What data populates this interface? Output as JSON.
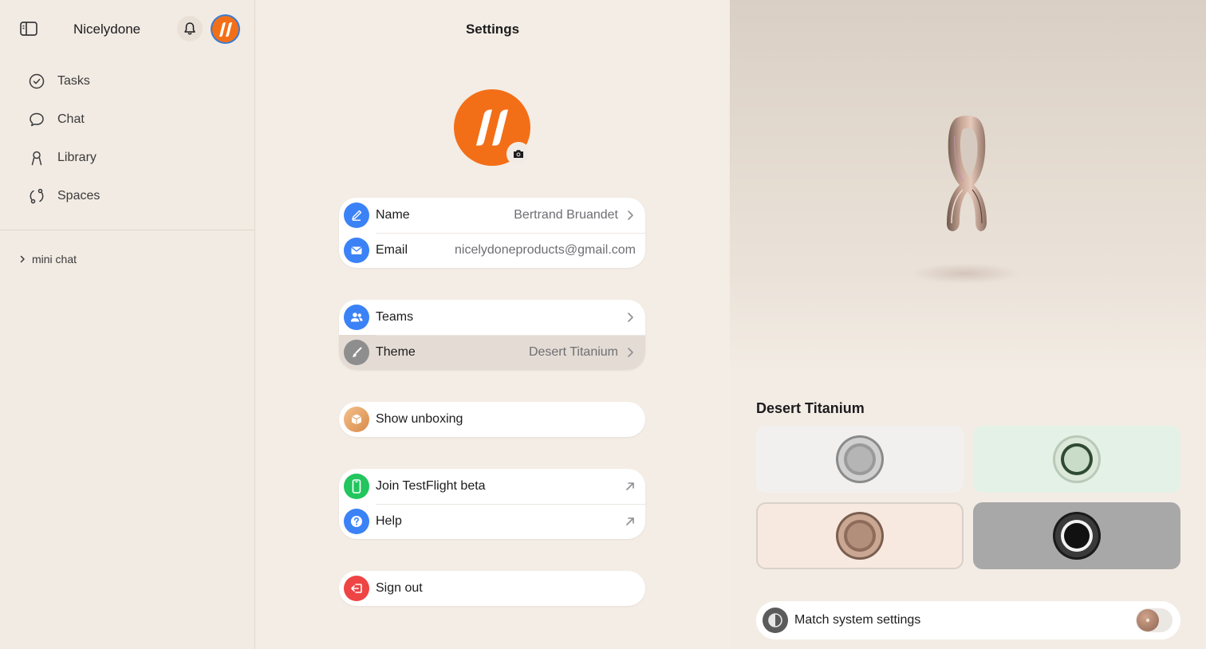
{
  "sidebar": {
    "title": "Nicelydone",
    "nav": [
      {
        "label": "Tasks"
      },
      {
        "label": "Chat"
      },
      {
        "label": "Library"
      },
      {
        "label": "Spaces"
      }
    ],
    "mini_chat_label": "mini chat"
  },
  "settings": {
    "title": "Settings",
    "name_label": "Name",
    "name_value": "Bertrand Bruandet",
    "email_label": "Email",
    "email_value": "nicelydoneproducts@gmail.com",
    "teams_label": "Teams",
    "theme_label": "Theme",
    "theme_value": "Desert Titanium",
    "unboxing_label": "Show unboxing",
    "testflight_label": "Join TestFlight beta",
    "help_label": "Help",
    "signout_label": "Sign out"
  },
  "preview": {
    "theme_name": "Desert Titanium",
    "match_label": "Match system settings",
    "themes": [
      "silver",
      "green",
      "desert",
      "black"
    ],
    "selected_theme": "desert"
  },
  "colors": {
    "brand": "#f36f17",
    "blue": "#3b82f6",
    "green": "#22c55e",
    "red": "#ef4444"
  }
}
